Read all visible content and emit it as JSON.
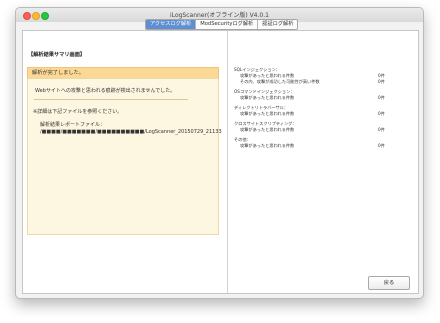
{
  "window": {
    "title": "iLogScanner(オフライン版) V4.0.1"
  },
  "tabs": [
    {
      "label": "アクセスログ解析",
      "active": true
    },
    {
      "label": "ModSecurityログ解析",
      "active": false
    },
    {
      "label": "認証ログ解析",
      "active": false
    }
  ],
  "left": {
    "heading": "【解析結果サマリ画面】",
    "banner": "解析が完了しました。",
    "result_message": "Webサイトへの攻撃と思われる痕跡が検出されませんでした。",
    "detail_note": "※詳細は下記ファイルを参照ください。",
    "report_label": "解析結果レポートファイル：",
    "report_path": "/■■■■/■■■■■■■/■■■■■■■■■■/LogScanner_20150729_21133"
  },
  "summary": [
    {
      "title": "SQLインジェクション：",
      "rows": [
        {
          "label": "攻撃があったと思われる件数",
          "count": "0件"
        },
        {
          "label": "その内、攻撃が成功した可能性が高い件数",
          "count": "0件"
        }
      ]
    },
    {
      "title": "OSコマンドインジェクション：",
      "rows": [
        {
          "label": "攻撃があったと思われる件数",
          "count": "0件"
        }
      ]
    },
    {
      "title": "ディレクトリトラバーサル：",
      "rows": [
        {
          "label": "攻撃があったと思われる件数",
          "count": "0件"
        }
      ]
    },
    {
      "title": "クロスサイトスクリプティング：",
      "rows": [
        {
          "label": "攻撃があったと思われる件数",
          "count": "0件"
        }
      ]
    },
    {
      "title": "その他：",
      "rows": [
        {
          "label": "攻撃があったと思われる件数",
          "count": "0件"
        }
      ]
    }
  ],
  "buttons": {
    "back": "戻る"
  },
  "colors": {
    "banner": "#fbd895",
    "panel": "#fdf6e1",
    "active_tab": "#5f8fd1"
  }
}
